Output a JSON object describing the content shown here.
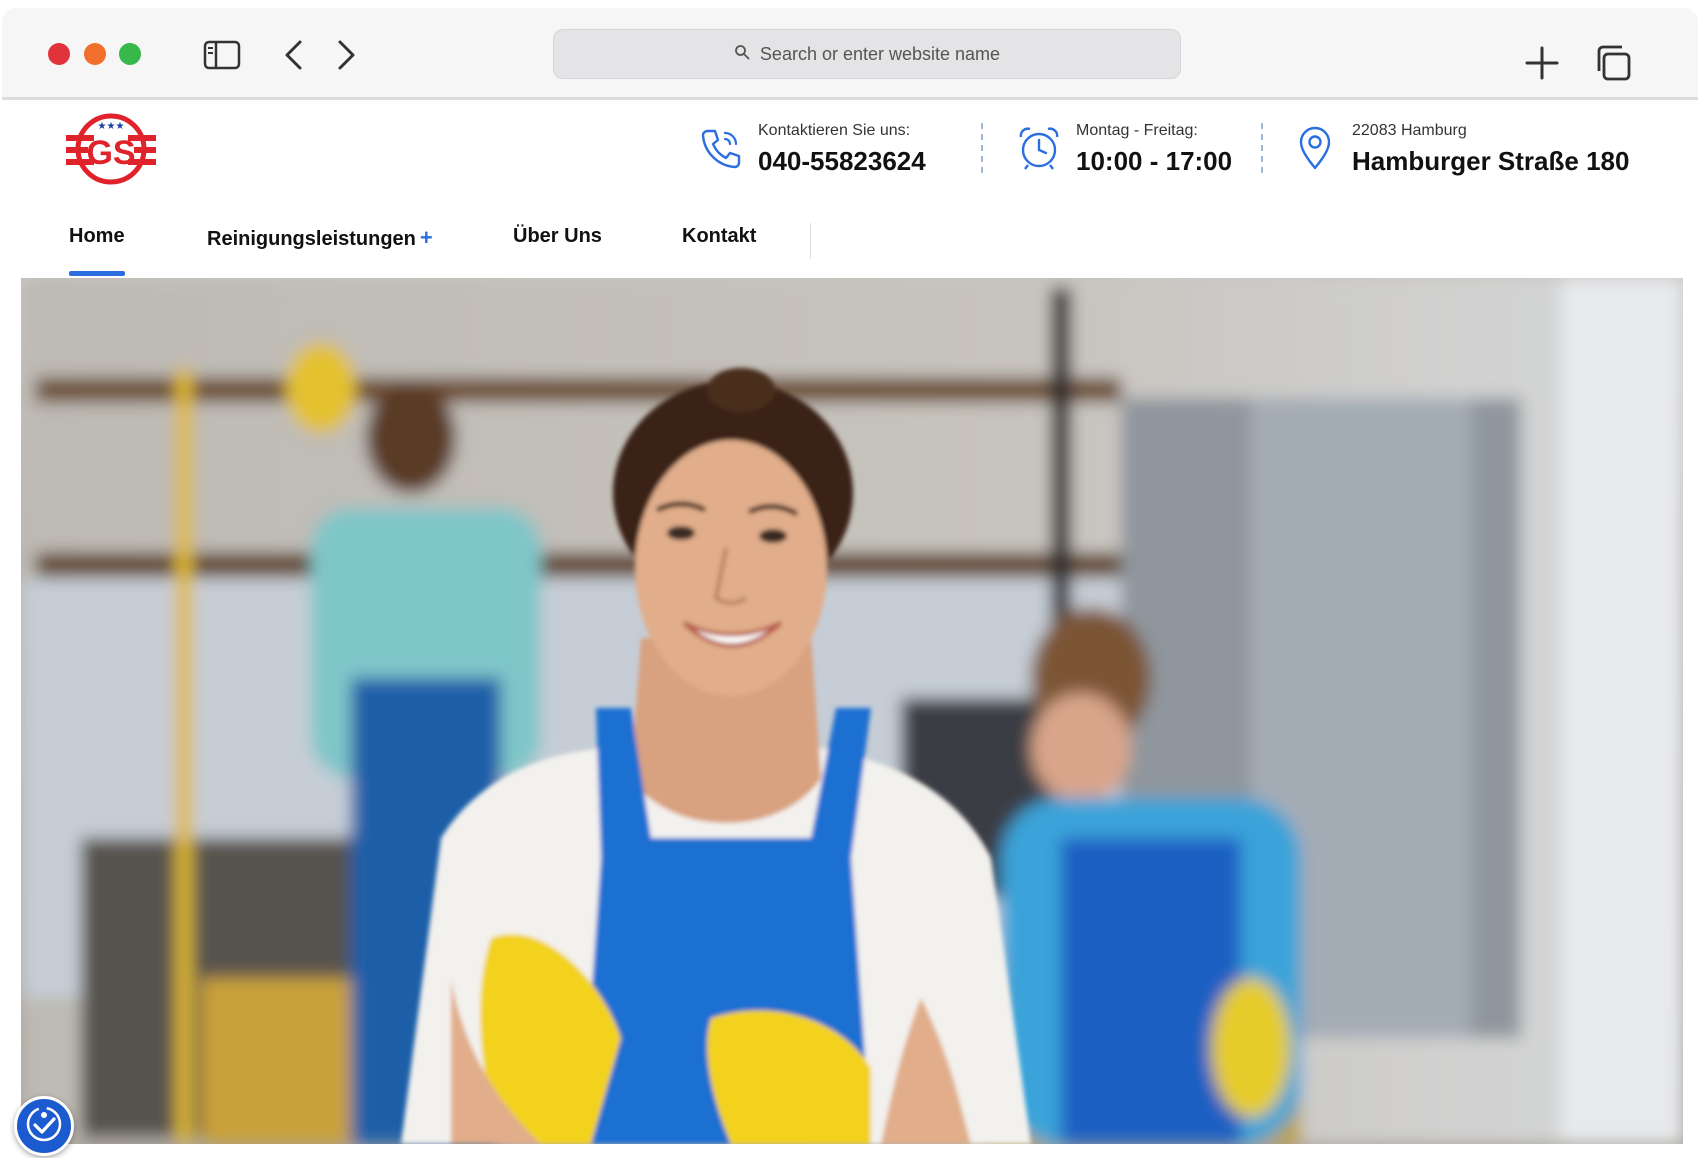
{
  "browser": {
    "url_placeholder": "Search or enter website name",
    "icons": [
      "sidebar-icon",
      "back-arrow-icon",
      "forward-arrow-icon",
      "search-icon",
      "plus-icon",
      "tabs-icon"
    ]
  },
  "header": {
    "logo_text": "GS",
    "phone": {
      "label": "Kontaktieren Sie uns:",
      "value": "040-55823624",
      "icon": "phone-icon"
    },
    "hours": {
      "label": "Montag - Freitag:",
      "value": "10:00 - 17:00",
      "icon": "alarm-clock-icon"
    },
    "address": {
      "label": "22083 Hamburg",
      "value": "Hamburger Straße 180",
      "icon": "location-pin-icon"
    }
  },
  "nav": {
    "items": [
      {
        "label": "Home",
        "active": true
      },
      {
        "label": "Reinigungsleistungen",
        "has_submenu": true,
        "submenu_symbol": "+"
      },
      {
        "label": "Über Uns"
      },
      {
        "label": "Kontakt"
      }
    ]
  },
  "hero": {
    "image": "smiling cleaning worker with blue apron and yellow gloves in kitchen, colleagues blurred in background"
  },
  "accessibility": {
    "icon": "accessibility-icon"
  },
  "colors": {
    "accent": "#2b6ee0",
    "logo_red": "#e0222b",
    "apron_blue": "#1f6fd1",
    "glove_yellow": "#f2d21a"
  }
}
